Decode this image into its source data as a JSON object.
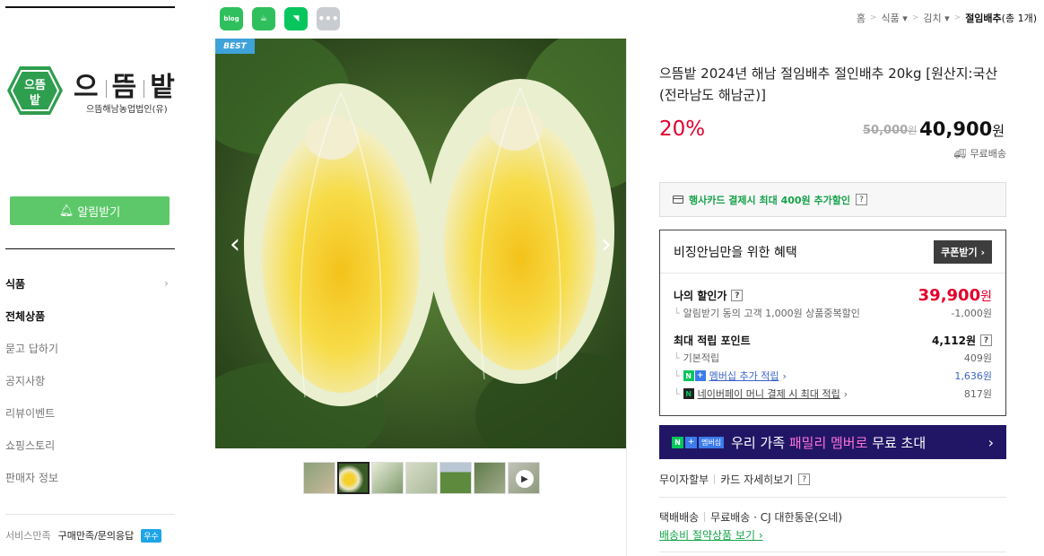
{
  "sidebar": {
    "logo": {
      "badge_text": "으뜸밭",
      "name_chars": [
        "으",
        "뜸",
        "밭"
      ],
      "subtitle": "으뜸해남농업법인(유)"
    },
    "alarm_button": "알림받기",
    "menu": [
      {
        "label": "식품",
        "has_chevron": true,
        "bold": true
      },
      {
        "label": "전체상품",
        "bold": true
      },
      {
        "label": "묻고 답하기"
      },
      {
        "label": "공지사항"
      },
      {
        "label": "리뷰이벤트"
      },
      {
        "label": "쇼핑스토리"
      },
      {
        "label": "판매자 정보"
      }
    ],
    "service": {
      "label": "서비스만족",
      "value": "구매만족/문의응답",
      "badge": "우수"
    }
  },
  "share_icons": [
    {
      "name": "blog-share-icon",
      "text": "blog"
    },
    {
      "name": "cafe-share-icon",
      "text": "☕"
    },
    {
      "name": "bookmark-share-icon",
      "text": "◥"
    },
    {
      "name": "more-share-icon",
      "text": "•••"
    }
  ],
  "breadcrumb": {
    "items": [
      "홈",
      "식품",
      "김치"
    ],
    "current": "절임배추",
    "current_count": "(총 1개)"
  },
  "product": {
    "best_badge": "BEST",
    "title": "으뜸밭 2024년 해남 절임배추 절인배추 20kg [원산지:국산(전라남도 해남군)]",
    "discount": "20%",
    "original_price": "50,000",
    "sale_price": "40,900",
    "won": "원",
    "free_shipping": "무료배송",
    "card_discount": "행사카드 결제시 최대 400원 추가할인",
    "question_mark": "?"
  },
  "benefits": {
    "heading": "비징안님만을 위한 혜택",
    "coupon_button": "쿠폰받기",
    "my_price_label": "나의 할인가",
    "my_price": "39,900",
    "alarm_discount_text": "알림받기 동의 고객 1,000원 상품중복할인",
    "alarm_discount_amount": "-1,000원",
    "max_points_label": "최대 적립 포인트",
    "max_points": "4,112원",
    "basic_label": "기본적립",
    "basic_amount": "409원",
    "membership_label": "멤버십 추가 적립",
    "membership_amount": "1,636원",
    "npay_label": "네이버페이 머니 결제 시 최대 적립",
    "npay_amount": "817원"
  },
  "banner": {
    "tag_text": "멤버십",
    "text_before": "우리 가족 ",
    "highlight": "패밀리 멤버로",
    "text_after": " 무료 초대"
  },
  "installment": {
    "label": "무이자할부",
    "card_details": "카드 자세히보기"
  },
  "delivery": {
    "method": "택배배송",
    "detail": "무료배송 · CJ 대한통운(오네)",
    "save_link": "배송비 절약상품 보기"
  },
  "colors": {
    "accent_green": "#5dc86a",
    "discount_red": "#e3002d",
    "banner_purple": "#211666",
    "banner_pink": "#ff72d9",
    "best_blue": "#3fa2d9"
  }
}
